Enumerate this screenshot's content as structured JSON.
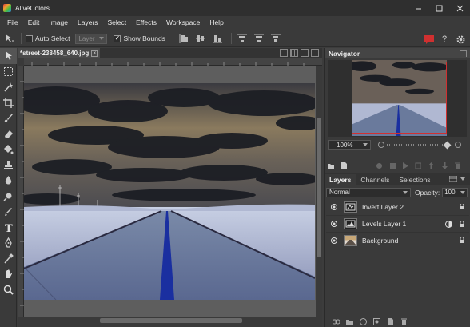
{
  "window": {
    "title": "AliveColors",
    "controls": [
      "minimize-icon",
      "maximize-icon",
      "close-icon"
    ]
  },
  "menu": [
    "File",
    "Edit",
    "Image",
    "Layers",
    "Select",
    "Effects",
    "Workspace",
    "Help"
  ],
  "options_bar": {
    "auto_select_label": "Auto Select",
    "auto_select_checked": false,
    "layer_select_value": "Layer",
    "show_bounds_label": "Show Bounds",
    "show_bounds_checked": true,
    "align_icons": [
      "align-left-icon",
      "align-center-icon",
      "align-right-icon",
      "distribute-top-icon",
      "distribute-middle-icon",
      "distribute-bottom-icon"
    ],
    "right_icons": [
      "message-icon",
      "help-icon",
      "settings-icon"
    ],
    "accent": "#d03030"
  },
  "tools": [
    "move-icon",
    "marquee-icon",
    "magic-wand-icon",
    "crop-icon",
    "brush-icon",
    "eraser-icon",
    "gradient-icon",
    "stamp-icon",
    "blur-icon",
    "smudge-icon",
    "dodge-icon",
    "pen-icon",
    "text-icon",
    "eyedropper-icon",
    "color-picker-icon",
    "hand-icon",
    "zoom-icon"
  ],
  "document": {
    "tab_title": "*street-238458_640.jpg",
    "image_alt": "Inverted photo of a straight road across a snowy plain under a dark cloudy sky"
  },
  "navigator": {
    "title": "Navigator",
    "zoom_value": "100%"
  },
  "layers_panel": {
    "tabs": [
      "Layers",
      "Channels",
      "Selections"
    ],
    "active_tab": "Layers",
    "blend_mode": "Normal",
    "opacity_label": "Opacity:",
    "opacity_value": "100",
    "layers": [
      {
        "name": "Invert Layer 2",
        "visible": true,
        "thumb": "invert-adjustment-icon"
      },
      {
        "name": "Levels Layer 1",
        "visible": true,
        "thumb": "levels-adjustment-icon"
      },
      {
        "name": "Background",
        "visible": true,
        "thumb": "image-thumbnail"
      }
    ]
  }
}
